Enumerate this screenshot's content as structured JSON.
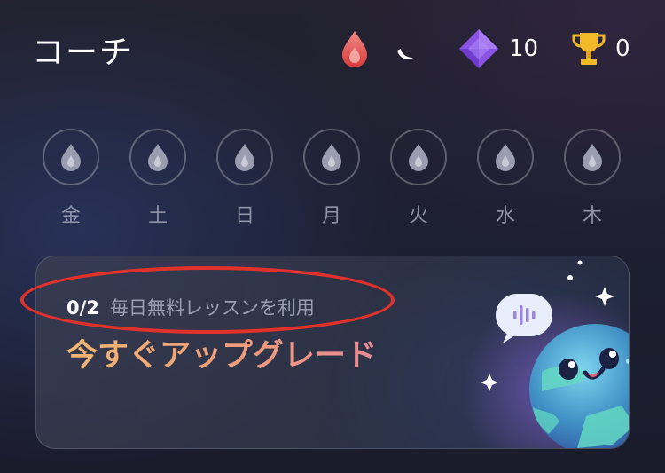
{
  "header": {
    "title": "コーチ",
    "streak_icon": "flame-drop-icon",
    "streak_color": "#e2504c",
    "moon_icon": "crescent-moon-icon",
    "gems_icon": "gem-icon",
    "gems_count": "10",
    "trophy_icon": "trophy-icon",
    "trophy_count": "0"
  },
  "week": {
    "days": [
      {
        "label": "金",
        "icon": "drop-icon"
      },
      {
        "label": "土",
        "icon": "drop-icon"
      },
      {
        "label": "日",
        "icon": "drop-icon"
      },
      {
        "label": "月",
        "icon": "drop-icon"
      },
      {
        "label": "火",
        "icon": "drop-icon"
      },
      {
        "label": "水",
        "icon": "drop-icon"
      },
      {
        "label": "木",
        "icon": "drop-icon"
      }
    ]
  },
  "upgrade_card": {
    "quota_count": "0/2",
    "quota_text": "毎日無料レッスンを利用",
    "cta": "今すぐアップグレード",
    "mascot_icon": "globe-mascot-icon",
    "speech_icon": "voice-bubble-icon",
    "highlight_color": "#e0322a"
  }
}
